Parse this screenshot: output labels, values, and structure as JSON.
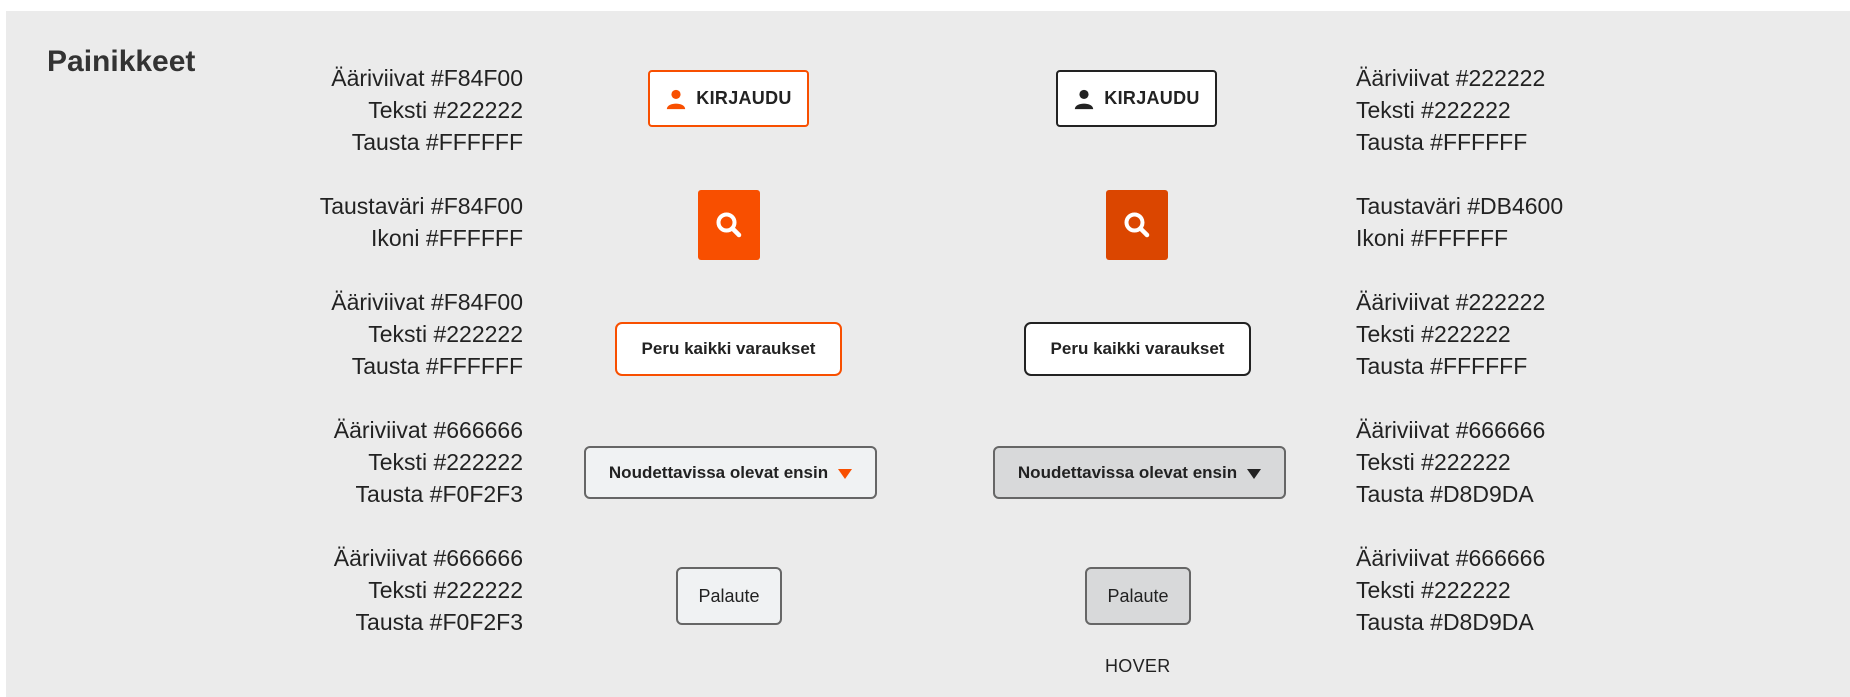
{
  "section_title": "Painikkeet",
  "colors": {
    "orange": "#F84F00",
    "orange_hover": "#DB4600",
    "dark": "#222222",
    "white": "#FFFFFF",
    "grey_border": "#666666",
    "light_bg": "#F0F2F3",
    "hover_bg": "#D8D9DA",
    "panel_bg": "#EBEBEB"
  },
  "rows": [
    {
      "left_desc": [
        "Ääriviivat #F84F00",
        "Teksti #222222",
        "Tausta #FFFFFF"
      ],
      "right_desc": [
        "Ääriviivat #222222",
        "Teksti #222222",
        "Tausta #FFFFFF"
      ],
      "button_label": "KIRJAUDU",
      "icon": "user-icon"
    },
    {
      "left_desc": [
        "Taustaväri #F84F00",
        "Ikoni #FFFFFF"
      ],
      "right_desc": [
        "Taustaväri #DB4600",
        "Ikoni #FFFFFF"
      ],
      "icon": "search-icon"
    },
    {
      "left_desc": [
        "Ääriviivat #F84F00",
        "Teksti #222222",
        "Tausta #FFFFFF"
      ],
      "right_desc": [
        "Ääriviivat #222222",
        "Teksti #222222",
        "Tausta #FFFFFF"
      ],
      "button_label": "Peru kaikki varaukset"
    },
    {
      "left_desc": [
        "Ääriviivat #666666",
        "Teksti #222222",
        "Tausta #F0F2F3"
      ],
      "right_desc": [
        "Ääriviivat #666666",
        "Teksti #222222",
        "Tausta #D8D9DA"
      ],
      "button_label": "Noudettavissa olevat ensin",
      "icon": "caret-down-icon"
    },
    {
      "left_desc": [
        "Ääriviivat #666666",
        "Teksti #222222",
        "Tausta #F0F2F3"
      ],
      "right_desc": [
        "Ääriviivat #666666",
        "Teksti #222222",
        "Tausta #D8D9DA"
      ],
      "button_label": "Palaute"
    }
  ],
  "hover_label": "HOVER"
}
